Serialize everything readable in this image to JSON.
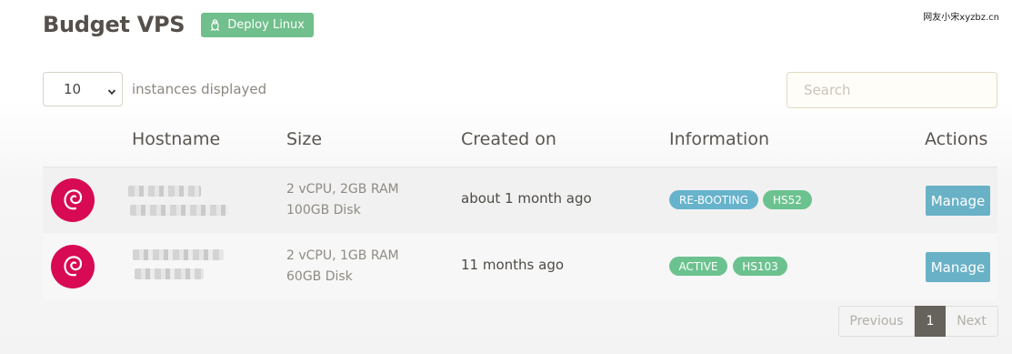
{
  "watermark": "网友小宋xyzbz.cn",
  "header": {
    "title": "Budget VPS",
    "deploy_label": "Deploy Linux"
  },
  "controls": {
    "page_length": "10",
    "page_length_suffix": "instances displayed",
    "search_placeholder": "Search"
  },
  "table": {
    "columns": [
      "Hostname",
      "Size",
      "Created on",
      "Information",
      "Actions"
    ],
    "rows": [
      {
        "os_icon": "debian-icon",
        "size_line1": "2 vCPU, 2GB RAM",
        "size_line2": "100GB Disk",
        "created": "about 1 month ago",
        "status": "RE-BOOTING",
        "node": "HS52",
        "action": "Manage"
      },
      {
        "os_icon": "debian-icon",
        "size_line1": "2 vCPU, 1GB RAM",
        "size_line2": "60GB Disk",
        "created": "11 months ago",
        "status": "ACTIVE",
        "node": "HS103",
        "action": "Manage"
      }
    ]
  },
  "pagination": {
    "previous": "Previous",
    "current": "1",
    "next": "Next"
  },
  "colors": {
    "accent_green": "#70bf8c",
    "accent_blue": "#69b1c6",
    "debian_red": "#d70a53"
  }
}
